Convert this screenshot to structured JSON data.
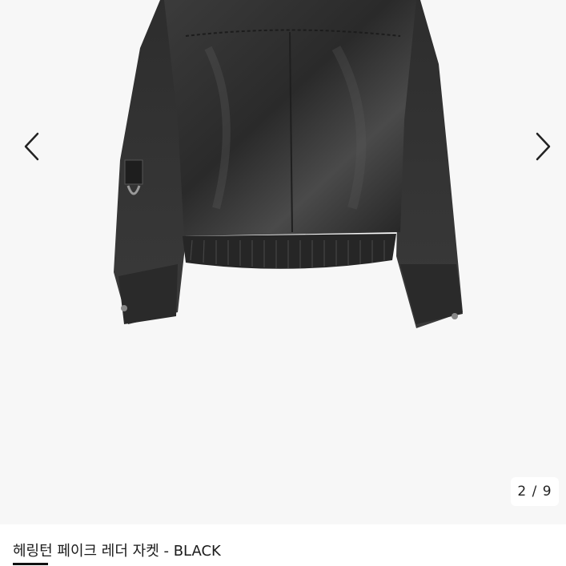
{
  "gallery": {
    "counter": {
      "current": "2",
      "total": "9",
      "separator": " / "
    },
    "prev_icon": "chevron-left-icon",
    "next_icon": "chevron-right-icon",
    "image_subject": "black faux leather jacket, back view",
    "colors": {
      "background": "#f7f7f7",
      "jacket": "#2b2b2b",
      "arrow": "#222222"
    }
  },
  "product": {
    "title": "헤링턴 페이크 레더 자켓 - BLACK"
  }
}
